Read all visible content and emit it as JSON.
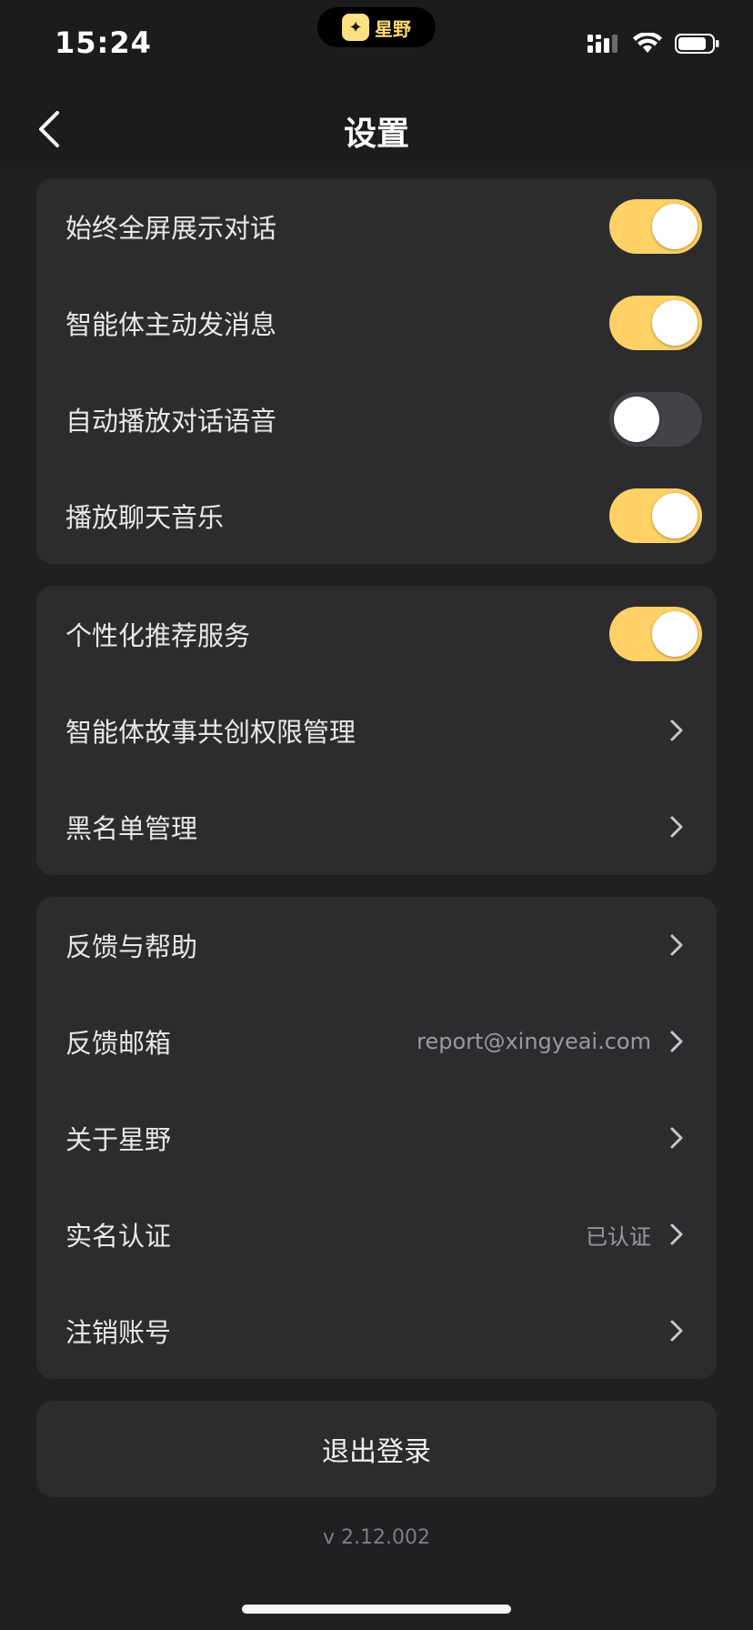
{
  "status_bar": {
    "time": "15:24",
    "island_app_name": "星野"
  },
  "nav": {
    "title": "设置"
  },
  "group_chat": {
    "items": [
      {
        "label": "始终全屏展示对话",
        "toggle": true
      },
      {
        "label": "智能体主动发消息",
        "toggle": true
      },
      {
        "label": "自动播放对话语音",
        "toggle": false
      },
      {
        "label": "播放聊天音乐",
        "toggle": true
      }
    ]
  },
  "group_privacy": {
    "items": [
      {
        "label": "个性化推荐服务",
        "toggle": true
      },
      {
        "label": "智能体故事共创权限管理"
      },
      {
        "label": "黑名单管理"
      }
    ]
  },
  "group_about": {
    "items": [
      {
        "label": "反馈与帮助"
      },
      {
        "label": "反馈邮箱",
        "value": "report@xingyeai.com"
      },
      {
        "label": "关于星野"
      },
      {
        "label": "实名认证",
        "value": "已认证"
      },
      {
        "label": "注销账号"
      }
    ]
  },
  "logout_label": "退出登录",
  "version": "v 2.12.002",
  "colors": {
    "accent": "#ffd166",
    "background": "#1c1c1e",
    "card": "#2c2c2f"
  }
}
